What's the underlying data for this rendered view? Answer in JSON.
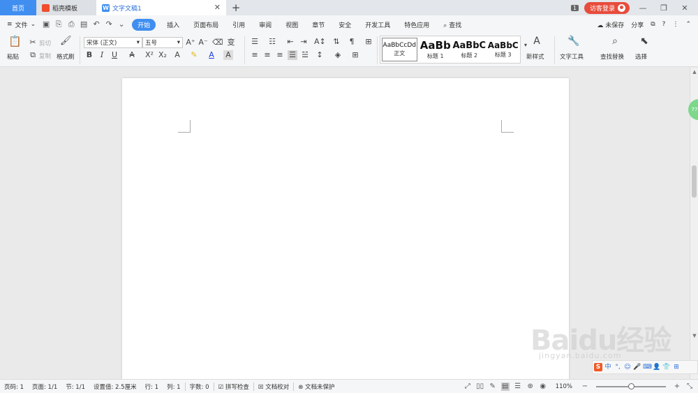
{
  "tabs": {
    "home": "首页",
    "template": "稻壳模板",
    "doc": "文字文稿1",
    "add": "+"
  },
  "titlebar": {
    "badge": "1",
    "login": "访客登录"
  },
  "menu": {
    "file": "文件",
    "items": [
      "开始",
      "插入",
      "页面布局",
      "引用",
      "审阅",
      "视图",
      "章节",
      "安全",
      "开发工具",
      "特色应用"
    ],
    "search": "查找",
    "unsaved": "未保存",
    "share": "分享",
    "help": "?"
  },
  "ribbon": {
    "paste": "粘贴",
    "cut": "剪切",
    "copy": "复制",
    "format_painter": "格式刷",
    "font_name": "宋体 (正文)",
    "font_size": "五号",
    "styles": [
      {
        "sample": "AaBbCcDd",
        "name": "正文"
      },
      {
        "sample": "AaBb",
        "name": "标题 1"
      },
      {
        "sample": "AaBbC",
        "name": "标题 2"
      },
      {
        "sample": "AaBbC",
        "name": "标题 3"
      }
    ],
    "new_style": "新样式",
    "text_tools": "文字工具",
    "find_replace": "查找替换",
    "select": "选择"
  },
  "statusbar": {
    "page_num": "页码: 1",
    "pages": "页面: 1/1",
    "section": "节: 1/1",
    "setting": "设置值: 2.5厘米",
    "row": "行: 1",
    "col": "列: 1",
    "word_count": "字数: 0",
    "spell_check": "拼写检查",
    "proofread": "文档校对",
    "protect": "文档未保护",
    "zoom": "110%",
    "zoom_level": 0.5
  },
  "watermark": {
    "main": "Baidu经验",
    "sub": "jingyan.baidu.com"
  },
  "side_float": "77"
}
